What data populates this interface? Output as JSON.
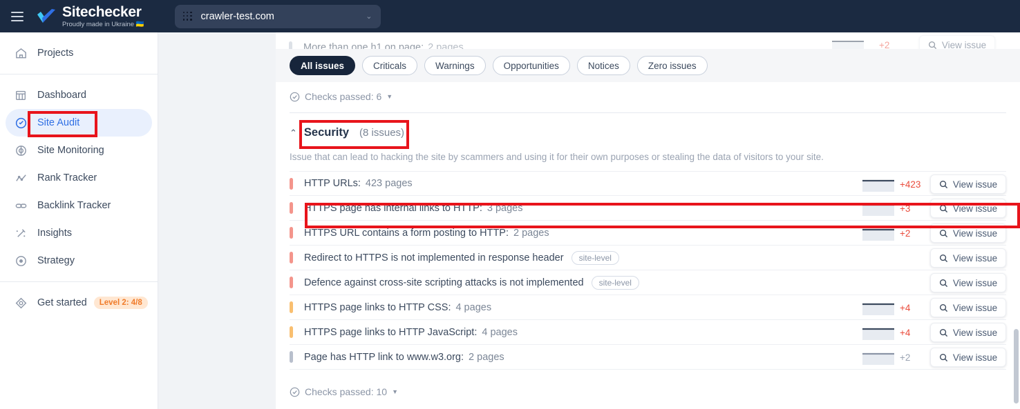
{
  "header": {
    "menu_icon": "hamburger-menu-icon",
    "brand_name": "Sitechecker",
    "brand_tagline": "Proudly made in Ukraine 🇺🇦",
    "site_selector": {
      "icon": "grid-dots-icon",
      "value": "crawler-test.com",
      "chevron": "⌄"
    }
  },
  "sidebar": {
    "groups": [
      {
        "items": [
          {
            "icon": "home-icon",
            "label": "Projects",
            "active": false
          }
        ]
      },
      {
        "items": [
          {
            "icon": "dashboard-icon",
            "label": "Dashboard",
            "active": false
          },
          {
            "icon": "site-audit-icon",
            "label": "Site Audit",
            "active": true
          },
          {
            "icon": "site-monitoring-icon",
            "label": "Site Monitoring",
            "active": false
          },
          {
            "icon": "rank-tracker-icon",
            "label": "Rank Tracker",
            "active": false
          },
          {
            "icon": "backlink-tracker-icon",
            "label": "Backlink Tracker",
            "active": false
          },
          {
            "icon": "insights-icon",
            "label": "Insights",
            "active": false
          },
          {
            "icon": "strategy-icon",
            "label": "Strategy",
            "active": false
          }
        ]
      },
      {
        "items": [
          {
            "icon": "get-started-icon",
            "label": "Get started",
            "active": false,
            "badge": "Level 2: 4/8"
          }
        ]
      }
    ]
  },
  "main": {
    "obscured_row": {
      "label": "More than one h1 on page:",
      "count": "2 pages",
      "delta": "+2",
      "button": "View issue"
    },
    "filters": [
      {
        "label": "All issues",
        "selected": true
      },
      {
        "label": "Criticals",
        "selected": false
      },
      {
        "label": "Warnings",
        "selected": false
      },
      {
        "label": "Opportunities",
        "selected": false
      },
      {
        "label": "Notices",
        "selected": false
      },
      {
        "label": "Zero issues",
        "selected": false
      }
    ],
    "checks_passed_top": "Checks passed: 6",
    "checks_passed_bottom": "Checks passed: 10",
    "section": {
      "chevron": "⌃",
      "title": "Security",
      "count": "(8 issues)",
      "description": "Issue that can lead to hacking the site by scammers and using it for their own purposes or stealing the data of visitors to your site."
    },
    "view_issue_label": "View issue",
    "site_level_tag": "site-level",
    "issues": [
      {
        "severity": "critical",
        "label": "HTTP URLs:",
        "count": "423 pages",
        "tag": "",
        "delta": "+423",
        "delta_color": "red",
        "has_spark": true
      },
      {
        "severity": "critical",
        "label": "HTTPS page has internal links to HTTP:",
        "count": "3 pages",
        "tag": "",
        "delta": "+3",
        "delta_color": "red",
        "has_spark": true
      },
      {
        "severity": "critical",
        "label": "HTTPS URL contains a form posting to HTTP:",
        "count": "2 pages",
        "tag": "",
        "delta": "+2",
        "delta_color": "red",
        "has_spark": true
      },
      {
        "severity": "critical",
        "label": "Redirect to HTTPS is not implemented in response header",
        "count": "",
        "tag": "site-level",
        "delta": "",
        "delta_color": "red",
        "has_spark": false
      },
      {
        "severity": "critical",
        "label": "Defence against cross-site scripting attacks is not implemented",
        "count": "",
        "tag": "site-level",
        "delta": "",
        "delta_color": "red",
        "has_spark": false
      },
      {
        "severity": "warning",
        "label": "HTTPS page links to HTTP CSS:",
        "count": "4 pages",
        "tag": "",
        "delta": "+4",
        "delta_color": "red",
        "has_spark": true
      },
      {
        "severity": "warning",
        "label": "HTTPS page links to HTTP JavaScript:",
        "count": "4 pages",
        "tag": "",
        "delta": "+4",
        "delta_color": "red",
        "has_spark": true
      },
      {
        "severity": "notice",
        "label": "Page has HTTP link to www.w3.org:",
        "count": "2 pages",
        "tag": "",
        "delta": "+2",
        "delta_color": "grey",
        "has_spark": true
      }
    ]
  },
  "colors": {
    "brand_dark": "#1b2a41",
    "accent_blue": "#2f6fe4",
    "critical": "#f4958c",
    "warning": "#f9bf70",
    "notice": "#b8bfcc",
    "delta_red": "#ea4c3c",
    "annotation_red": "#e8141b",
    "level_badge_bg": "#ffe7d2",
    "level_badge_text": "#f07b2a"
  },
  "annotations": [
    {
      "name": "site-audit-highlight"
    },
    {
      "name": "security-header-highlight"
    },
    {
      "name": "https-internal-links-row-highlight"
    }
  ]
}
